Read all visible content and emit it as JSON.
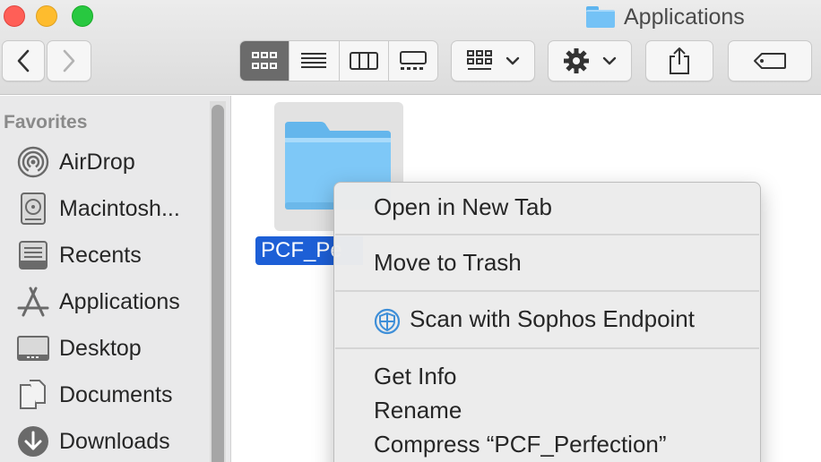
{
  "window": {
    "title": "Applications"
  },
  "toolbar": {
    "back_icon": "chevron-left-icon",
    "forward_icon": "chevron-right-icon",
    "view_modes": [
      "icon-view",
      "list-view",
      "column-view",
      "gallery-view"
    ],
    "active_view": "icon-view",
    "group_icon": "group-by-icon",
    "action_icon": "gear-icon",
    "share_icon": "share-icon",
    "tag_icon": "tag-icon"
  },
  "sidebar": {
    "heading": "Favorites",
    "items": [
      {
        "label": "AirDrop",
        "icon": "airdrop-icon"
      },
      {
        "label": "Macintosh...",
        "icon": "hard-disk-icon"
      },
      {
        "label": "Recents",
        "icon": "recents-icon"
      },
      {
        "label": "Applications",
        "icon": "applications-icon"
      },
      {
        "label": "Desktop",
        "icon": "desktop-icon"
      },
      {
        "label": "Documents",
        "icon": "documents-icon"
      },
      {
        "label": "Downloads",
        "icon": "downloads-icon"
      }
    ]
  },
  "content": {
    "selected_file_label": "PCF_Pe"
  },
  "context_menu": {
    "items": {
      "open_new_tab": "Open in New Tab",
      "move_to_trash": "Move to Trash",
      "scan_sophos": "Scan with Sophos Endpoint",
      "get_info": "Get Info",
      "rename": "Rename",
      "compress": "Compress “PCF_Perfection”"
    }
  },
  "colors": {
    "selection": "#1d5fd6",
    "folder": "#74c2f6",
    "sophos_icon": "#3f8fd8"
  }
}
